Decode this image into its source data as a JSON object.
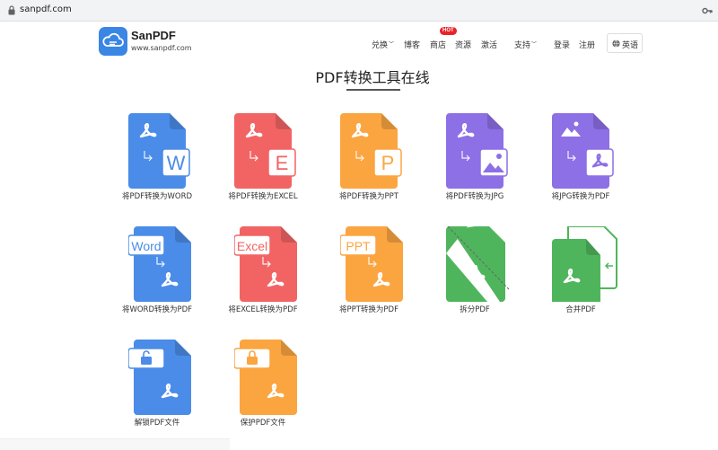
{
  "browser": {
    "url": "sanpdf.com"
  },
  "logo": {
    "name": "SanPDF",
    "sub": "www.sanpdf.com"
  },
  "nav": {
    "items": [
      {
        "label": "兑换",
        "dropdown": true
      },
      {
        "label": "博客",
        "dropdown": false
      },
      {
        "label": "商店",
        "dropdown": false,
        "badge": "HOT"
      },
      {
        "label": "资源",
        "dropdown": false
      },
      {
        "label": "激活",
        "dropdown": false
      },
      {
        "label": "支持",
        "dropdown": true
      },
      {
        "label": "登录",
        "dropdown": false
      },
      {
        "label": "注册",
        "dropdown": false
      }
    ],
    "language": "英语"
  },
  "page": {
    "title": "PDF转换工具在线"
  },
  "tools": [
    {
      "label": "将PDF转换为WORD",
      "color": "#4a8ce8",
      "badge": "W"
    },
    {
      "label": "将PDF转换为EXCEL",
      "color": "#f26464",
      "badge": "E"
    },
    {
      "label": "将PDF转换为PPT",
      "color": "#fba541",
      "badge": "P"
    },
    {
      "label": "将PDF转换为JPG",
      "color": "#8d6fe6",
      "badge": ""
    },
    {
      "label": "将JPG转换为PDF",
      "color": "#8d6fe6",
      "badge": ""
    },
    {
      "label": "将WORD转换为PDF",
      "color": "#4a8ce8",
      "badge": "Word"
    },
    {
      "label": "将EXCEL转换为PDF",
      "color": "#f26464",
      "badge": "Excel"
    },
    {
      "label": "将PPT转换为PDF",
      "color": "#fba541",
      "badge": "PPT"
    },
    {
      "label": "拆分PDF",
      "color": "#4fb55c",
      "badge": ""
    },
    {
      "label": "合并PDF",
      "color": "#4fb55c",
      "badge": ""
    },
    {
      "label": "解锁PDF文件",
      "color": "#4a8ce8",
      "badge": ""
    },
    {
      "label": "保护PDF文件",
      "color": "#fba541",
      "badge": ""
    }
  ],
  "icons": {
    "lock": "lock-icon",
    "key": "key-icon",
    "globe": "globe-icon",
    "acrobat": "acrobat-icon",
    "arrow": "arrow-icon"
  }
}
